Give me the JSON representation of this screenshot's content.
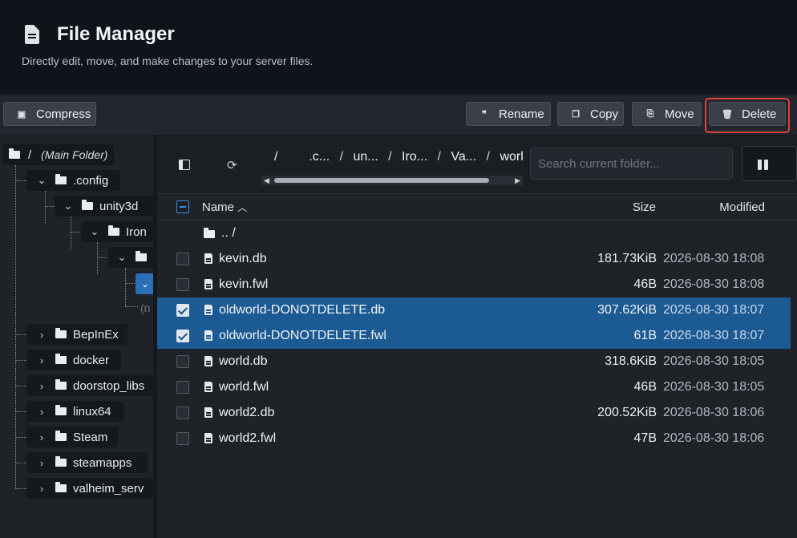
{
  "header": {
    "title": "File Manager",
    "subtitle": "Directly edit, move, and make changes to your server files.",
    "icon": "document-icon"
  },
  "toolbar": {
    "compress_label": "Compress",
    "rename_label": "Rename",
    "copy_label": "Copy",
    "move_label": "Move",
    "delete_label": "Delete",
    "delete_highlight_color": "#e0403f"
  },
  "tree": {
    "root_label": "/",
    "root_sub": "(Main Folder)",
    "config_label": ".config",
    "unity_label": "unity3d",
    "iron_label": "Iron",
    "null_label": "(n",
    "top_folders": [
      "BepInEx",
      "docker",
      "doorstop_libs",
      "linux64",
      "Steam",
      "steamapps",
      "valheim_serv"
    ]
  },
  "browser": {
    "breadcrumbs": [
      "/",
      ".c...",
      "un...",
      "Iro...",
      "Va...",
      "worlds_l"
    ],
    "search_placeholder": "Search current folder...",
    "columns": {
      "name": "Name",
      "size": "Size",
      "modified": "Modified"
    },
    "parent_dir": ".. /",
    "files": [
      {
        "name": "kevin.db",
        "size": "181.73KiB",
        "modified": "2026-08-30 18:08",
        "selected": false
      },
      {
        "name": "kevin.fwl",
        "size": "46B",
        "modified": "2026-08-30 18:08",
        "selected": false
      },
      {
        "name": "oldworld-DONOTDELETE.db",
        "size": "307.62KiB",
        "modified": "2026-08-30 18:07",
        "selected": true
      },
      {
        "name": "oldworld-DONOTDELETE.fwl",
        "size": "61B",
        "modified": "2026-08-30 18:07",
        "selected": true
      },
      {
        "name": "world.db",
        "size": "318.6KiB",
        "modified": "2026-08-30 18:05",
        "selected": false
      },
      {
        "name": "world.fwl",
        "size": "46B",
        "modified": "2026-08-30 18:05",
        "selected": false
      },
      {
        "name": "world2.db",
        "size": "200.52KiB",
        "modified": "2026-08-30 18:06",
        "selected": false
      },
      {
        "name": "world2.fwl",
        "size": "47B",
        "modified": "2026-08-30 18:06",
        "selected": false
      }
    ]
  }
}
